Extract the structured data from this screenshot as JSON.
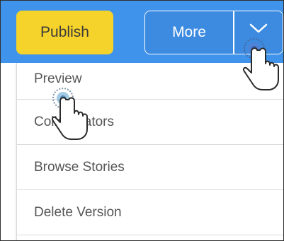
{
  "toolbar": {
    "publish_label": "Publish",
    "more_label": "More",
    "caret_icon": "chevron-down-icon"
  },
  "menu": {
    "items": [
      {
        "label": "Preview"
      },
      {
        "label": "Collaborators"
      },
      {
        "label": "Browse Stories"
      },
      {
        "label": "Delete Version"
      }
    ]
  },
  "colors": {
    "toolbar_bg": "#3f93ea",
    "publish_bg": "#f6d32a",
    "more_bg": "#3d8be0"
  }
}
